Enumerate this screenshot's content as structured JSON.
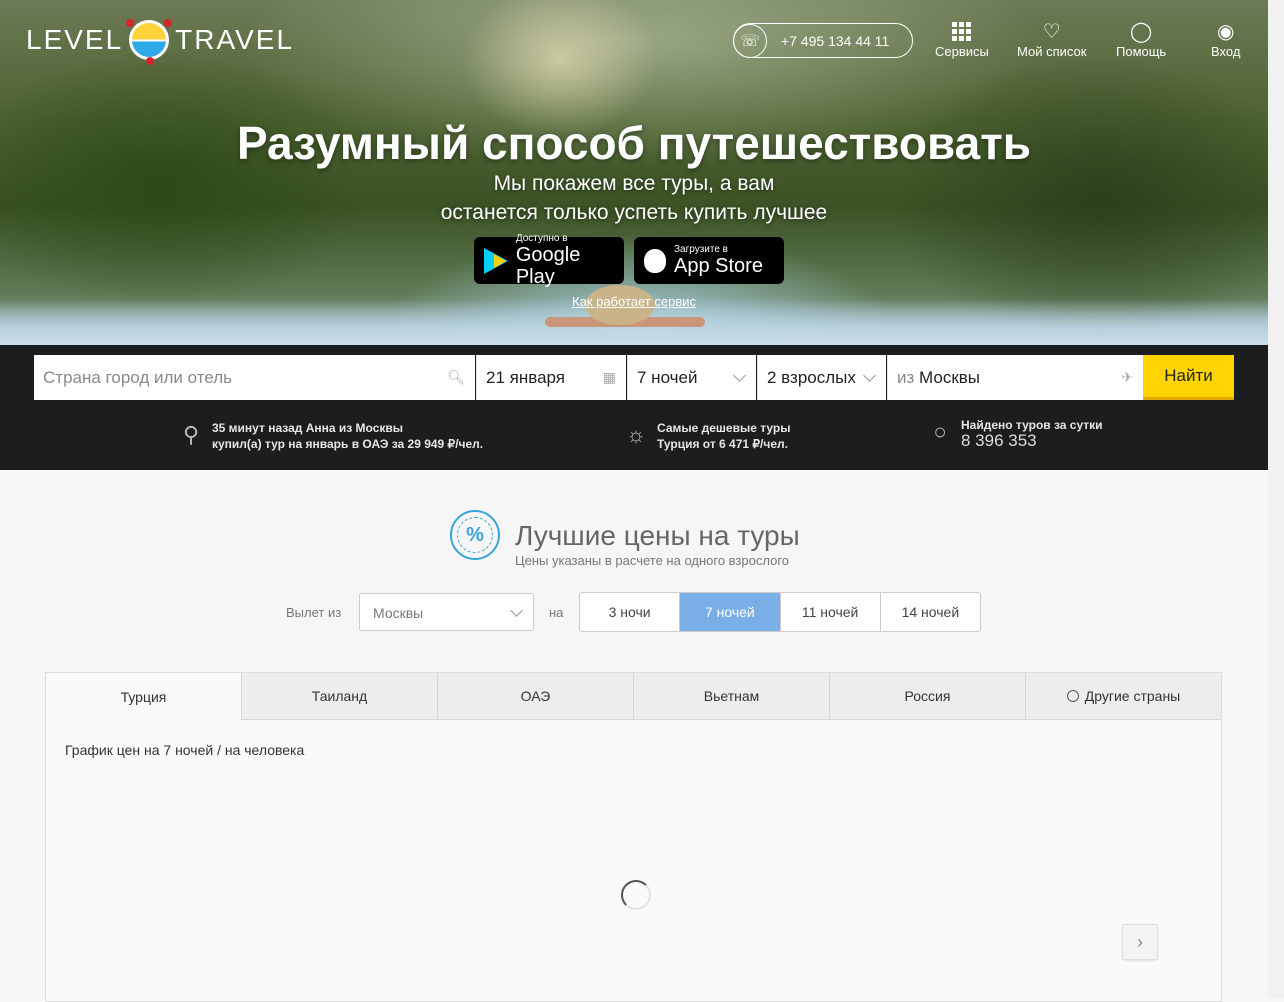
{
  "brand": {
    "left": "LEVEL",
    "right": "TRAVEL"
  },
  "header": {
    "phone": "+7 495 134 44 11",
    "nav": [
      {
        "label": "Сервисы",
        "icon": "grid-icon"
      },
      {
        "label": "Мой список",
        "icon": "heart-icon"
      },
      {
        "label": "Помощь",
        "icon": "bulb-icon"
      },
      {
        "label": "Вход",
        "icon": "user-icon"
      }
    ]
  },
  "hero": {
    "title": "Разумный способ путешествовать",
    "subtitle_line1": "Мы покажем все туры, а вам",
    "subtitle_line2": "останется только успеть купить лучшее",
    "google_small": "Доступно в",
    "google_big": "Google Play",
    "apple_small": "Загрузите в",
    "apple_big": "App Store",
    "how_link": "Как работает сервис"
  },
  "search": {
    "destination_placeholder": "Страна город или отель",
    "date": "21 января",
    "nights": "7 ночей",
    "guests": "2 взрослых",
    "from_prefix": "из",
    "from_city": "Москвы",
    "submit": "Найти"
  },
  "ticker": {
    "recent_line1": "35 минут назад Анна из Москвы",
    "recent_line2": "купил(а) тур на январь в ОАЭ за 29 949 ₽/чел.",
    "cheap_line1": "Самые дешевые туры",
    "cheap_line2": "Турция от 6 471 ₽/чел.",
    "found_label": "Найдено туров за сутки",
    "found_count": "8 396 353"
  },
  "best": {
    "title": "Лучшие цены на туры",
    "subtitle": "Цены указаны в расчете на одного взрослого",
    "from_label": "Вылет из",
    "from_value": "Москвы",
    "on_label": "на",
    "nights": [
      "3 ночи",
      "7 ночей",
      "11 ночей",
      "14 ночей"
    ],
    "active_night": "7 ночей"
  },
  "tabs": [
    "Турция",
    "Таиланд",
    "ОАЭ",
    "Вьетнам",
    "Россия",
    "Другие страны"
  ],
  "chart": {
    "title": "График цен на 7 ночей / на человека"
  },
  "colors": {
    "accent_yellow": "#ffd400",
    "active_blue": "#7aaee6",
    "icon_blue": "#3aa3d8"
  }
}
